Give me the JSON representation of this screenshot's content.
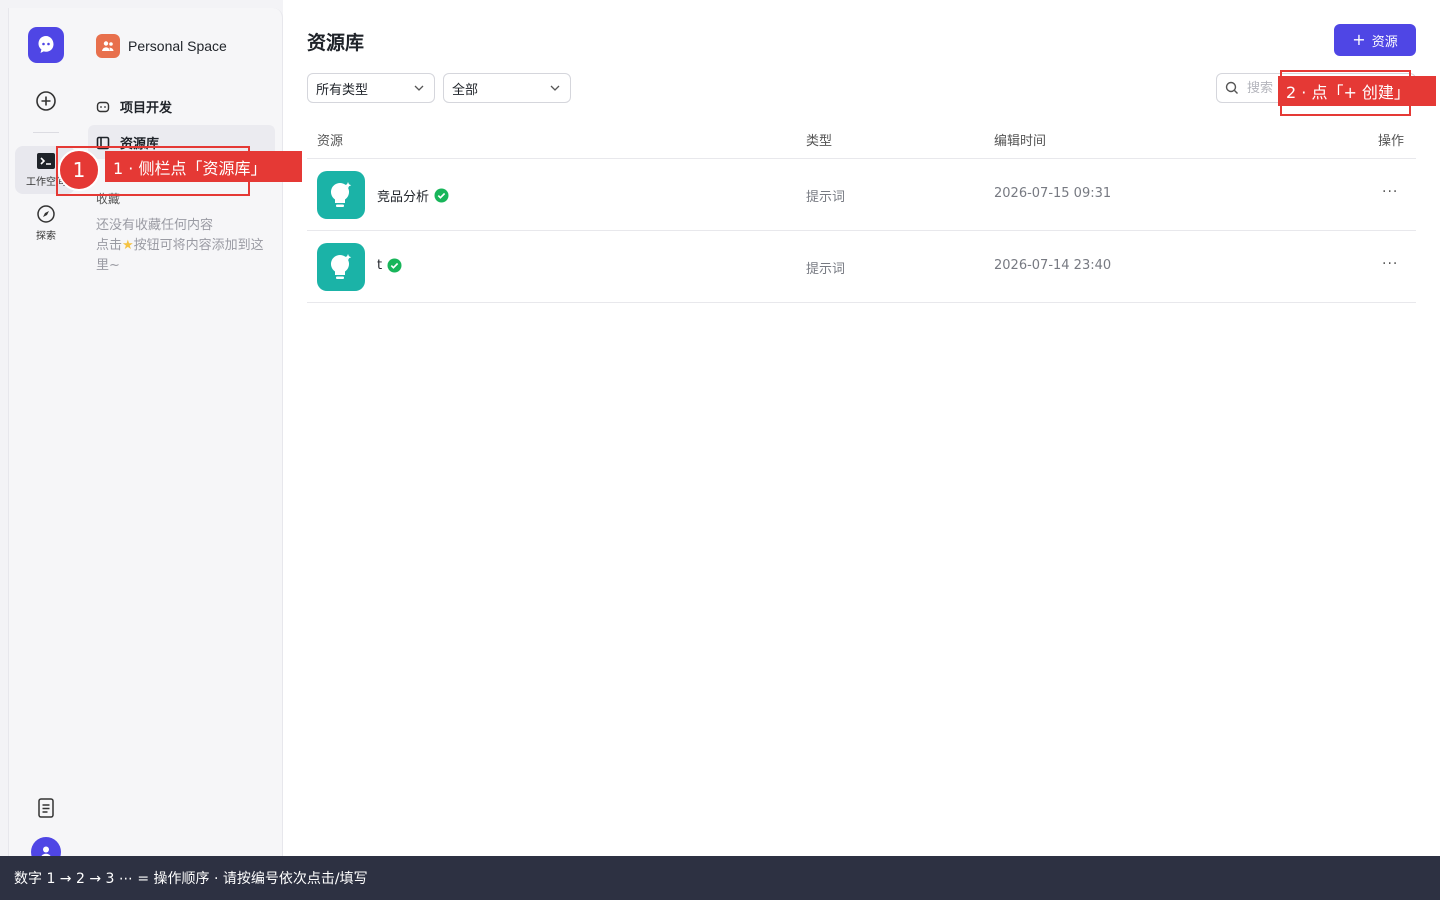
{
  "rail": {
    "workspace_label": "工作空间",
    "explore_label": "探索"
  },
  "sidebar": {
    "space_name": "Personal Space",
    "nav": [
      {
        "label": "项目开发"
      },
      {
        "label": "资源库"
      }
    ],
    "favorites_title": "收藏",
    "favorites_empty_line1": "还没有收藏任何内容",
    "favorites_empty_line2a": "点击",
    "favorites_empty_line2b": "按钮可将内容添加到这里~"
  },
  "main": {
    "title": "资源库",
    "add_button_label": "资源",
    "filter_type": "所有类型",
    "filter_scope": "全部",
    "search_placeholder": "搜索",
    "columns": {
      "resource": "资源",
      "type": "类型",
      "edited": "编辑时间",
      "actions": "操作"
    },
    "rows": [
      {
        "name": "竞品分析",
        "type": "提示词",
        "edited": "2026-07-15 09:31",
        "more": "···"
      },
      {
        "name": "t",
        "type": "提示词",
        "edited": "2026-07-14 23:40",
        "more": "···"
      }
    ]
  },
  "annotations": {
    "step1_number": "1",
    "step1_text": "1 ·   侧栏点「资源库」",
    "step2_text": "2 ·    点「+ 创建」"
  },
  "footer": {
    "instruction": "数字 1 → 2 → 3 ⋯ = 操作顺序 ·   请按编号依次点击/填写"
  },
  "colors": {
    "accent": "#4f46e5",
    "annotation_red": "#e53935",
    "resource_icon_teal": "#1bb3a7",
    "verified_green": "#18b55a"
  }
}
